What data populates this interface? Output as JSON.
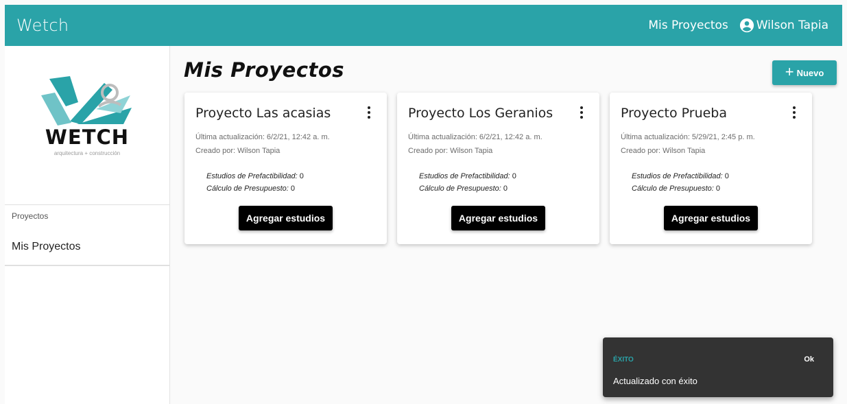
{
  "header": {
    "brand": "Wetch",
    "nav_link": "Mis Proyectos",
    "user_name": "Wilson Tapia",
    "color": "#2aa3a8"
  },
  "sidebar": {
    "logo": {
      "word": "WETCH",
      "tagline": "arquitectura + construcción"
    },
    "section_caption": "Proyectos",
    "items": [
      {
        "label": "Mis Proyectos"
      }
    ]
  },
  "main": {
    "title": "Mis Proyectos",
    "new_button": "Nuevo",
    "projects": [
      {
        "title": "Proyecto Las acasias",
        "updated": "Última actualización: 6/2/21, 12:42 a. m.",
        "created_by": "Creado por: Wilson Tapia",
        "prefactibilidad_label": "Estudios de Prefactibilidad:",
        "prefactibilidad_count": "0",
        "presupuesto_label": "Cálculo de Presupuesto:",
        "presupuesto_count": "0",
        "action": "Agregar estudios"
      },
      {
        "title": "Proyecto Los Geranios",
        "updated": "Última actualización: 6/2/21, 12:42 a. m.",
        "created_by": "Creado por: Wilson Tapia",
        "prefactibilidad_label": "Estudios de Prefactibilidad:",
        "prefactibilidad_count": "0",
        "presupuesto_label": "Cálculo de Presupuesto:",
        "presupuesto_count": "0",
        "action": "Agregar estudios"
      },
      {
        "title": "Proyecto Prueba",
        "updated": "Última actualización: 5/29/21, 2:45 p. m.",
        "created_by": "Creado por: Wilson Tapia",
        "prefactibilidad_label": "Estudios de Prefactibilidad:",
        "prefactibilidad_count": "0",
        "presupuesto_label": "Cálculo de Presupuesto:",
        "presupuesto_count": "0",
        "action": "Agregar estudios"
      }
    ]
  },
  "snackbar": {
    "title": "ÉXITO",
    "action": "Ok",
    "message": "Actualizado con éxito"
  }
}
